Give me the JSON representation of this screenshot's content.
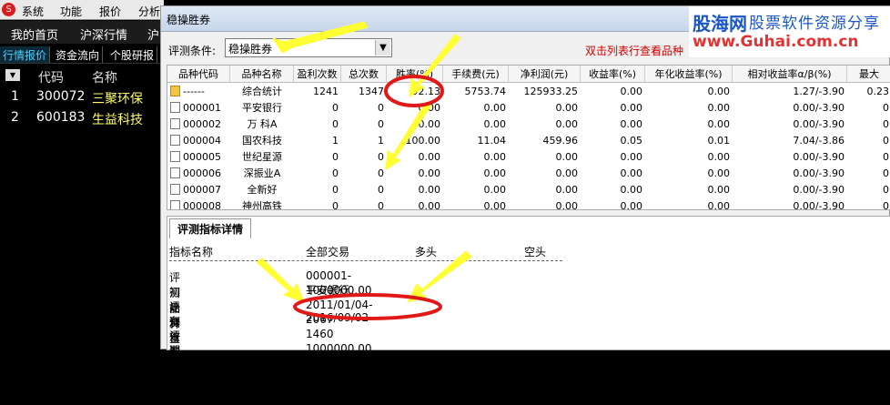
{
  "menubar": {
    "items": [
      "系统",
      "功能",
      "报价",
      "分析"
    ]
  },
  "navbar": {
    "items": [
      "我的首页",
      "沪深行情",
      "沪"
    ]
  },
  "subbar": {
    "items": [
      "行情报价",
      "资金流向",
      "个股研报"
    ]
  },
  "stock_list": {
    "headers": [
      "代码",
      "名称"
    ],
    "rows": [
      {
        "num": "1",
        "code": "300072",
        "name": "三聚环保"
      },
      {
        "num": "2",
        "code": "600183",
        "name": "生益科技"
      }
    ]
  },
  "window": {
    "title": "稳操胜券"
  },
  "watermark": {
    "brand": "股海网",
    "slogan": "股票软件资源分享",
    "url": "www.Guhai.com.cn"
  },
  "condition": {
    "label": "评测条件:",
    "value": "稳操胜券",
    "hint": "双击列表行查看品种"
  },
  "table": {
    "headers": [
      "品种代码",
      "品种名称",
      "盈利次数",
      "总次数",
      "胜率(%)",
      "手续费(元)",
      "净利润(元)",
      "收益率(%)",
      "年化收益率(%)",
      "相对收益率α/β(%)",
      "最大"
    ],
    "rows": [
      {
        "code": "------",
        "name": "综合统计",
        "wins": "1241",
        "total": "1347",
        "rate": "92.13",
        "fee": "5753.74",
        "profit": "125933.25",
        "ret": "0.00",
        "annual": "0.00",
        "rel": "1.27/-3.90",
        "max": "0.23"
      },
      {
        "code": "000001",
        "name": "平安银行",
        "wins": "0",
        "total": "0",
        "rate": "0.00",
        "fee": "0.00",
        "profit": "0.00",
        "ret": "0.00",
        "annual": "0.00",
        "rel": "0.00/-3.90",
        "max": "0"
      },
      {
        "code": "000002",
        "name": "万 科A",
        "wins": "0",
        "total": "0",
        "rate": "0.00",
        "fee": "0.00",
        "profit": "0.00",
        "ret": "0.00",
        "annual": "0.00",
        "rel": "0.00/-3.90",
        "max": "0"
      },
      {
        "code": "000004",
        "name": "国农科技",
        "wins": "1",
        "total": "1",
        "rate": "100.00",
        "fee": "11.04",
        "profit": "459.96",
        "ret": "0.05",
        "annual": "0.01",
        "rel": "7.04/-3.86",
        "max": "0"
      },
      {
        "code": "000005",
        "name": "世纪星源",
        "wins": "0",
        "total": "0",
        "rate": "0.00",
        "fee": "0.00",
        "profit": "0.00",
        "ret": "0.00",
        "annual": "0.00",
        "rel": "0.00/-3.90",
        "max": "0"
      },
      {
        "code": "000006",
        "name": "深振业A",
        "wins": "0",
        "total": "0",
        "rate": "0.00",
        "fee": "0.00",
        "profit": "0.00",
        "ret": "0.00",
        "annual": "0.00",
        "rel": "0.00/-3.90",
        "max": "0"
      },
      {
        "code": "000007",
        "name": "全新好",
        "wins": "0",
        "total": "0",
        "rate": "0.00",
        "fee": "0.00",
        "profit": "0.00",
        "ret": "0.00",
        "annual": "0.00",
        "rel": "0.00/-3.90",
        "max": "0"
      },
      {
        "code": "000008",
        "name": "神州高铁",
        "wins": "0",
        "total": "0",
        "rate": "0.00",
        "fee": "0.00",
        "profit": "0.00",
        "ret": "0.00",
        "annual": "0.00",
        "rel": "0.00/-3.90",
        "max": "0"
      }
    ]
  },
  "detail": {
    "tab": "评测指标详情",
    "headers": [
      "指标名称",
      "全部交易",
      "多头",
      "空头"
    ],
    "rows": [
      {
        "k": "评测品种",
        "v": "000001-平安银行"
      },
      {
        "k": "初始资金",
        "v": "1000000.00"
      },
      {
        "k": "评测日期",
        "v": "2011/01/04-2016/09/02"
      },
      {
        "k": "有效天数",
        "v": "2067"
      },
      {
        "k": "评测周期数",
        "v": "1460"
      },
      {
        "k": "期末权益",
        "v": "1000000.00"
      }
    ]
  },
  "colors": {
    "annotation_arrow": "#ffff33",
    "annotation_circle": "#e01818"
  }
}
